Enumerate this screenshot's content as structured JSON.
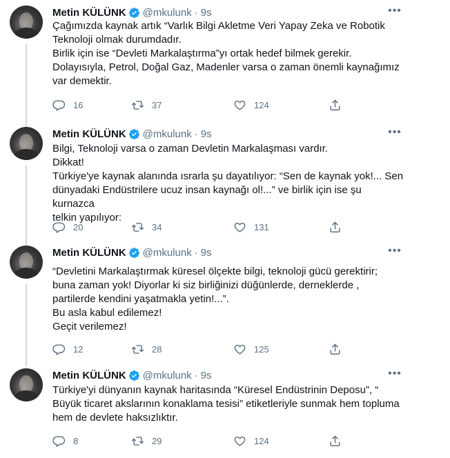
{
  "tweets": [
    {
      "name": "Metin KÜLÜNK",
      "handle": "@mkulunk",
      "sep": "·",
      "time": "9s",
      "lines": [
        "Çağımızda kaynak artık “Varlık Bilgi Akletme Veri  Yapay Zeka ve Robotik",
        "Teknoloji  olmak durumdadır.",
        "Birlik için ise “Devleti Markalaştırma”yı ortak  hedef bilmek gerekir.",
        "Dolayısıyla, Petrol, Doğal Gaz, Madenler varsa o zaman önemli kaynağımız",
        "var demektir."
      ],
      "replies": "16",
      "retweets": "37",
      "likes": "124"
    },
    {
      "name": "Metin KÜLÜNK",
      "handle": "@mkulunk",
      "sep": "·",
      "time": "9s",
      "lines": [
        "Bilgi, Teknoloji varsa o zaman Devletin Markalaşması vardır.",
        "Dikkat!",
        "Türkiye'ye kaynak alanında ısrarla şu dayatılıyor: “Sen de kaynak yok!... Sen",
        "dünyadaki Endüstrilere ucuz insan kaynağı ol!...” ve birlik için ise şu kurnazca",
        "telkin yapılıyor:"
      ],
      "replies": "20",
      "retweets": "34",
      "likes": "131"
    },
    {
      "name": "Metin KÜLÜNK",
      "handle": "@mkulunk",
      "sep": "·",
      "time": "9s",
      "lines": [
        "“Devletini Markalaştırmak küresel ölçekte bilgi, teknoloji gücü gerektirir;",
        "buna zaman yok! Diyorlar ki siz birliğinizi düğünlerde, derneklerde ,",
        " partilerde kendini yaşatmakla yetin!...”.",
        "Bu asla  kabul edilemez!",
        "Geçit verilemez!"
      ],
      "replies": "12",
      "retweets": "28",
      "likes": "125"
    },
    {
      "name": "Metin KÜLÜNK",
      "handle": "@mkulunk",
      "sep": "·",
      "time": "9s",
      "lines": [
        "Türkiye'yi dünyanın kaynak haritasında “Küresel Endüstrinin Deposu”, “",
        "Büyük ticaret akslarının konaklama tesisi” etiketleriyle sunmak hem topluma",
        "hem de devlete haksızlıktır."
      ],
      "replies": "8",
      "retweets": "29",
      "likes": "124"
    }
  ],
  "colors": {
    "text": "#0f1419",
    "secondary": "#5b7083",
    "verified": "#1da1f2",
    "thread_line": "#cfd9de"
  },
  "icons": {
    "reply": "reply-icon",
    "retweet": "retweet-icon",
    "like": "like-icon",
    "share": "share-icon",
    "verified": "verified-badge-icon",
    "more": "more-icon"
  }
}
